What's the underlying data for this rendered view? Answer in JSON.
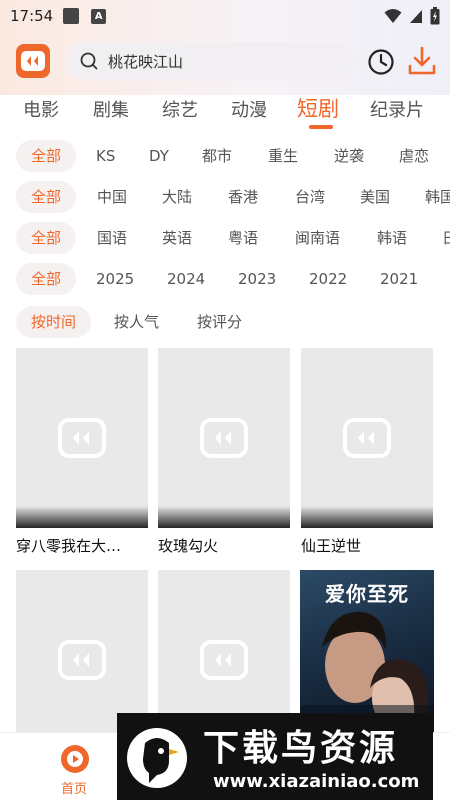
{
  "status_bar": {
    "time": "17:54"
  },
  "search": {
    "placeholder": "桃花映江山"
  },
  "categories": [
    "电影",
    "剧集",
    "综艺",
    "动漫",
    "短剧",
    "纪录片"
  ],
  "active_category": "短剧",
  "filters": {
    "type": [
      "全部",
      "KS",
      "DY",
      "都市",
      "重生",
      "逆袭",
      "虐恋"
    ],
    "region": [
      "全部",
      "中国",
      "大陆",
      "香港",
      "台湾",
      "美国",
      "韩国"
    ],
    "language": [
      "全部",
      "国语",
      "英语",
      "粤语",
      "闽南语",
      "韩语",
      "日"
    ],
    "year": [
      "全部",
      "2025",
      "2024",
      "2023",
      "2022",
      "2021"
    ],
    "sort": [
      "按时间",
      "按人气",
      "按评分"
    ]
  },
  "items": [
    {
      "title": "穿八零我在大…"
    },
    {
      "title": "玫瑰勾火"
    },
    {
      "title": "仙王逆世"
    }
  ],
  "poster": {
    "title": "爱你至死"
  },
  "bottom_nav": {
    "home_label": "首页"
  },
  "watermark": {
    "brand": "下载鸟资源",
    "url": "www.xiazainiao.com"
  },
  "colors": {
    "accent": "#f0672b"
  }
}
